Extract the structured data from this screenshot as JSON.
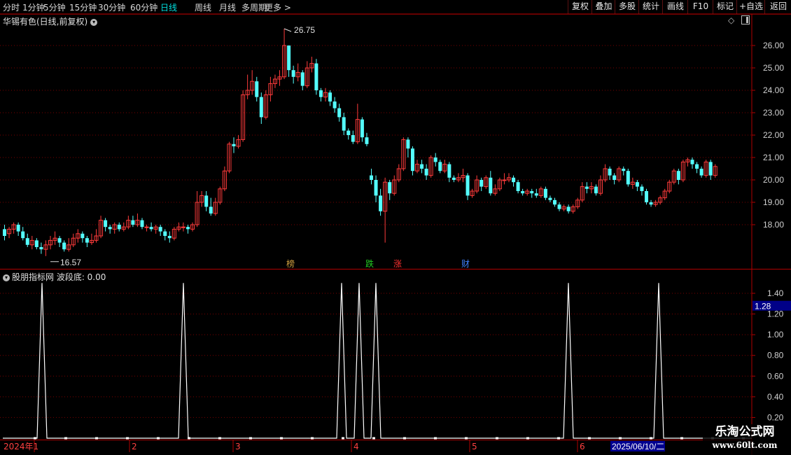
{
  "toolbar": {
    "periods": [
      "分时",
      "1分钟",
      "5分钟",
      "15分钟",
      "30分钟",
      "60分钟",
      "日线",
      "周线",
      "月线",
      "多周期",
      "更多 >"
    ],
    "active_period": "日线",
    "right_buttons": [
      "复权",
      "叠加",
      "多股",
      "统计",
      "画线",
      "F10",
      "标记",
      "+自选",
      "返回"
    ]
  },
  "chart": {
    "title": "华锡有色(日线,前复权)",
    "high_label": "26.75",
    "low_label": "16.57",
    "price_ticks": [
      "26.00",
      "25.00",
      "24.00",
      "23.00",
      "22.00",
      "21.00",
      "20.00",
      "19.00",
      "18.00"
    ],
    "event_markers": [
      {
        "label": "榜",
        "color": "#d0a040"
      },
      {
        "label": "跌",
        "color": "#22cc22"
      },
      {
        "label": "涨",
        "color": "#ff3030"
      },
      {
        "label": "财",
        "color": "#4080ff"
      }
    ]
  },
  "indicator": {
    "title": "股朋指标网 波段底: 0.00",
    "ticks": [
      "1.40",
      "1.20",
      "1.00",
      "0.80",
      "0.60",
      "0.40",
      "0.20"
    ],
    "current_value": "1.28"
  },
  "x_axis": {
    "labels": [
      "2024年1",
      "2",
      "3",
      "4",
      "5",
      "6"
    ],
    "cursor_date": "2025/06/10/二"
  },
  "watermark": {
    "line1": "乐淘公式网",
    "line2": "www.60lt.com"
  },
  "colors": {
    "up": "#ff3b3b",
    "down": "#54ffff",
    "border": "#b00000",
    "grid": "#7a0000"
  },
  "icons": {
    "collapse": "chevron-down-icon",
    "diamond": "diamond-icon",
    "panel": "panel-toggle-icon"
  },
  "chart_data": {
    "type": "candlestick",
    "ylim": [
      16.5,
      27
    ],
    "candles": [
      [
        17.8,
        17.5,
        18.0,
        17.3
      ],
      [
        17.6,
        17.8,
        17.9,
        17.4
      ],
      [
        17.8,
        18.0,
        18.1,
        17.6
      ],
      [
        18.0,
        17.7,
        18.1,
        17.5
      ],
      [
        17.7,
        17.4,
        17.9,
        17.3
      ],
      [
        17.4,
        17.1,
        17.6,
        17.0
      ],
      [
        17.1,
        17.3,
        17.5,
        16.9
      ],
      [
        17.3,
        17.0,
        17.4,
        16.9
      ],
      [
        17.0,
        16.9,
        17.2,
        16.7
      ],
      [
        16.9,
        17.1,
        17.3,
        16.6
      ],
      [
        17.1,
        17.3,
        17.5,
        16.9
      ],
      [
        17.3,
        17.4,
        17.7,
        17.1
      ],
      [
        17.4,
        17.2,
        17.5,
        17.0
      ],
      [
        17.2,
        16.9,
        17.3,
        16.8
      ],
      [
        16.9,
        17.1,
        17.4,
        16.8
      ],
      [
        17.1,
        17.4,
        17.6,
        17.0
      ],
      [
        17.4,
        17.6,
        17.8,
        17.2
      ],
      [
        17.6,
        17.4,
        17.7,
        17.2
      ],
      [
        17.4,
        17.2,
        17.5,
        17.0
      ],
      [
        17.2,
        17.3,
        17.6,
        17.1
      ],
      [
        17.3,
        17.5,
        17.8,
        17.2
      ],
      [
        17.5,
        18.2,
        18.4,
        17.4
      ],
      [
        18.2,
        17.9,
        18.3,
        17.7
      ],
      [
        17.9,
        17.8,
        18.0,
        17.6
      ],
      [
        17.8,
        18.0,
        18.1,
        17.6
      ],
      [
        18.0,
        17.8,
        18.1,
        17.7
      ],
      [
        17.8,
        17.9,
        18.1,
        17.7
      ],
      [
        17.9,
        18.2,
        18.4,
        17.8
      ],
      [
        18.2,
        18.0,
        18.4,
        17.9
      ],
      [
        18.0,
        18.2,
        18.5,
        17.9
      ],
      [
        18.2,
        17.9,
        18.3,
        17.8
      ],
      [
        17.9,
        17.9,
        18.0,
        17.7
      ],
      [
        17.9,
        17.8,
        18.1,
        17.7
      ],
      [
        17.8,
        17.9,
        18.0,
        17.6
      ],
      [
        17.9,
        17.7,
        18.0,
        17.5
      ],
      [
        17.7,
        17.5,
        17.8,
        17.3
      ],
      [
        17.5,
        17.4,
        17.7,
        17.2
      ],
      [
        17.4,
        17.8,
        17.9,
        17.3
      ],
      [
        17.8,
        17.9,
        18.1,
        17.7
      ],
      [
        17.9,
        17.9,
        18.1,
        17.7
      ],
      [
        17.9,
        17.8,
        18.0,
        17.6
      ],
      [
        17.8,
        18.0,
        18.1,
        17.7
      ],
      [
        18.0,
        19.0,
        19.5,
        17.9
      ],
      [
        19.0,
        19.3,
        19.5,
        18.8
      ],
      [
        19.3,
        18.8,
        19.5,
        18.6
      ],
      [
        18.8,
        18.5,
        19.2,
        18.4
      ],
      [
        18.5,
        19.0,
        19.2,
        18.4
      ],
      [
        19.0,
        19.6,
        19.7,
        18.9
      ],
      [
        19.6,
        20.4,
        20.6,
        19.5
      ],
      [
        20.4,
        21.6,
        21.7,
        20.3
      ],
      [
        21.6,
        21.5,
        21.9,
        21.2
      ],
      [
        21.5,
        21.8,
        22.0,
        21.4
      ],
      [
        21.8,
        23.8,
        24.0,
        21.7
      ],
      [
        23.8,
        24.0,
        24.7,
        23.6
      ],
      [
        24.0,
        24.4,
        24.9,
        23.8
      ],
      [
        24.4,
        23.7,
        24.6,
        23.5
      ],
      [
        23.7,
        22.8,
        23.9,
        22.5
      ],
      [
        22.8,
        23.8,
        24.0,
        22.7
      ],
      [
        23.8,
        24.3,
        24.6,
        23.5
      ],
      [
        24.3,
        24.5,
        24.7,
        24.1
      ],
      [
        24.5,
        24.6,
        24.9,
        24.2
      ],
      [
        24.6,
        26.0,
        26.75,
        24.5
      ],
      [
        26.0,
        24.9,
        26.0,
        24.6
      ],
      [
        24.9,
        24.6,
        25.1,
        24.3
      ],
      [
        24.6,
        24.8,
        25.2,
        24.4
      ],
      [
        24.8,
        24.2,
        24.9,
        24.0
      ],
      [
        24.2,
        25.0,
        25.3,
        24.1
      ],
      [
        25.0,
        25.2,
        25.5,
        24.8
      ],
      [
        25.2,
        24.0,
        25.4,
        23.8
      ],
      [
        24.0,
        23.7,
        24.1,
        23.5
      ],
      [
        23.7,
        23.9,
        24.1,
        23.5
      ],
      [
        23.9,
        23.5,
        24.0,
        23.3
      ],
      [
        23.5,
        23.2,
        23.7,
        23.0
      ],
      [
        23.2,
        22.8,
        23.4,
        22.6
      ],
      [
        22.8,
        22.2,
        23.0,
        22.0
      ],
      [
        22.2,
        22.0,
        22.3,
        21.8
      ],
      [
        22.0,
        21.7,
        22.2,
        21.6
      ],
      [
        21.7,
        22.7,
        23.4,
        21.6
      ],
      [
        22.7,
        21.9,
        22.8,
        21.7
      ],
      [
        21.9,
        21.6,
        22.1,
        21.5
      ],
      [
        20.2,
        20.0,
        20.5,
        19.8
      ],
      [
        20.0,
        19.3,
        20.2,
        19.0
      ],
      [
        19.3,
        18.6,
        19.6,
        18.4
      ],
      [
        18.6,
        19.9,
        20.1,
        17.2
      ],
      [
        19.9,
        19.4,
        20.0,
        19.1
      ],
      [
        19.4,
        20.0,
        20.2,
        19.3
      ],
      [
        20.0,
        20.5,
        20.7,
        19.9
      ],
      [
        20.5,
        21.8,
        21.9,
        20.4
      ],
      [
        21.8,
        21.4,
        21.9,
        21.0
      ],
      [
        21.4,
        20.4,
        21.5,
        20.2
      ],
      [
        20.4,
        20.7,
        20.9,
        20.3
      ],
      [
        20.7,
        20.5,
        20.9,
        20.3
      ],
      [
        20.5,
        20.2,
        20.7,
        20.0
      ],
      [
        20.2,
        21.0,
        21.1,
        20.1
      ],
      [
        21.0,
        20.8,
        21.2,
        20.6
      ],
      [
        20.8,
        20.4,
        20.9,
        20.3
      ],
      [
        20.4,
        20.7,
        20.9,
        20.3
      ],
      [
        20.7,
        20.1,
        20.8,
        19.9
      ],
      [
        20.1,
        20.0,
        20.2,
        19.9
      ],
      [
        20.0,
        20.1,
        20.3,
        19.9
      ],
      [
        20.1,
        20.2,
        20.5,
        19.9
      ],
      [
        20.2,
        19.3,
        20.3,
        19.1
      ],
      [
        19.3,
        19.5,
        19.6,
        19.2
      ],
      [
        19.5,
        20.0,
        20.2,
        19.4
      ],
      [
        20.0,
        19.7,
        20.1,
        19.5
      ],
      [
        19.7,
        20.1,
        20.2,
        19.6
      ],
      [
        20.1,
        19.4,
        20.4,
        19.3
      ],
      [
        19.4,
        19.6,
        19.8,
        19.3
      ],
      [
        19.6,
        20.0,
        20.1,
        19.5
      ],
      [
        20.0,
        20.0,
        20.3,
        19.8
      ],
      [
        20.0,
        20.1,
        20.3,
        19.9
      ],
      [
        20.1,
        19.9,
        20.2,
        19.7
      ],
      [
        19.9,
        19.5,
        20.0,
        19.4
      ],
      [
        19.5,
        19.4,
        19.6,
        19.3
      ],
      [
        19.4,
        19.5,
        19.6,
        19.3
      ],
      [
        19.5,
        19.4,
        19.6,
        19.2
      ],
      [
        19.4,
        19.3,
        19.6,
        19.2
      ],
      [
        19.3,
        19.6,
        19.7,
        19.2
      ],
      [
        19.6,
        19.2,
        19.7,
        19.1
      ],
      [
        19.2,
        19.1,
        19.3,
        19.0
      ],
      [
        19.1,
        18.9,
        19.2,
        18.8
      ],
      [
        18.9,
        18.7,
        19.0,
        18.6
      ],
      [
        18.7,
        18.8,
        18.9,
        18.6
      ],
      [
        18.8,
        18.6,
        18.9,
        18.5
      ],
      [
        18.6,
        18.8,
        18.9,
        18.5
      ],
      [
        18.8,
        19.1,
        19.2,
        18.7
      ],
      [
        19.1,
        19.7,
        19.9,
        19.0
      ],
      [
        19.7,
        19.6,
        19.9,
        19.4
      ],
      [
        19.6,
        19.7,
        19.9,
        19.4
      ],
      [
        19.7,
        19.4,
        19.8,
        19.3
      ],
      [
        19.4,
        20.0,
        20.2,
        19.3
      ],
      [
        20.0,
        20.5,
        20.7,
        19.9
      ],
      [
        20.5,
        20.2,
        20.6,
        20.0
      ],
      [
        20.2,
        20.0,
        20.3,
        19.8
      ],
      [
        20.0,
        20.5,
        20.6,
        19.9
      ],
      [
        20.5,
        20.4,
        20.6,
        20.2
      ],
      [
        20.4,
        19.8,
        20.5,
        19.7
      ],
      [
        19.8,
        19.9,
        20.1,
        19.6
      ],
      [
        19.9,
        19.7,
        20.0,
        19.5
      ],
      [
        19.7,
        19.5,
        19.8,
        19.3
      ],
      [
        19.5,
        19.0,
        19.6,
        18.9
      ],
      [
        19.0,
        18.9,
        19.1,
        18.8
      ],
      [
        18.9,
        19.0,
        19.1,
        18.8
      ],
      [
        19.0,
        19.2,
        19.3,
        18.9
      ],
      [
        19.2,
        19.5,
        19.6,
        19.1
      ],
      [
        19.5,
        19.9,
        20.0,
        19.4
      ],
      [
        19.9,
        20.4,
        20.5,
        19.8
      ],
      [
        20.4,
        20.0,
        20.5,
        19.8
      ],
      [
        20.0,
        20.8,
        20.9,
        19.9
      ],
      [
        20.8,
        20.9,
        21.0,
        20.6
      ],
      [
        20.9,
        20.7,
        21.0,
        20.5
      ],
      [
        20.7,
        20.5,
        20.8,
        20.3
      ],
      [
        20.5,
        20.2,
        20.6,
        20.1
      ],
      [
        20.2,
        20.8,
        20.9,
        20.1
      ],
      [
        20.8,
        20.2,
        20.9,
        20.0
      ],
      [
        20.2,
        20.6,
        20.7,
        20.1
      ]
    ],
    "indicator_peaks_index": [
      13,
      60,
      115,
      121,
      127,
      190,
      220
    ],
    "indicator_peak_value": 1.5
  }
}
